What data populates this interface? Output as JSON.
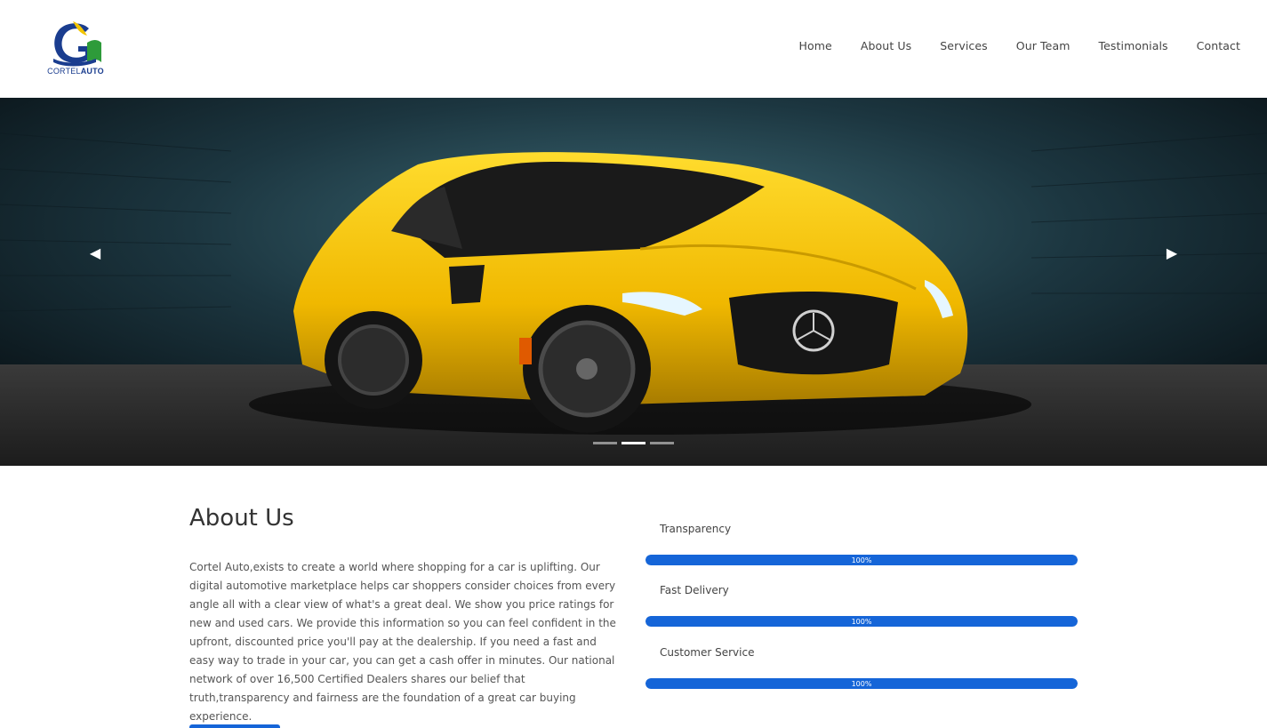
{
  "brand": {
    "logo_name_a": "CORTEL",
    "logo_name_b": "AUTO"
  },
  "nav": {
    "items": [
      "Home",
      "About Us",
      "Services",
      "Our Team",
      "Testimonials",
      "Contact"
    ]
  },
  "carousel": {
    "prev_label": "Previous",
    "next_label": "Next",
    "slide_count": 3,
    "active_index": 1
  },
  "about": {
    "title": "About Us",
    "body": "Cortel Auto,exists to create a world where shopping for a car is uplifting. Our digital automotive marketplace helps car shoppers consider choices from every angle all with a clear view of what's a great deal. We show you price ratings for new and used cars. We provide this information so you can feel confident in the upfront, discounted price you'll pay at the dealership. If you need a fast and easy way to trade in your car, you can get a cash offer in minutes. Our national network of over 16,500 Certified Dealers shares our belief that truth,transparency and fairness are the foundation of a great car buying experience."
  },
  "skills": [
    {
      "label": "Transparency",
      "value": 100,
      "value_text": "100%"
    },
    {
      "label": "Fast Delivery",
      "value": 100,
      "value_text": "100%"
    },
    {
      "label": "Customer Service",
      "value": 100,
      "value_text": "100%"
    }
  ],
  "colors": {
    "accent": "#1565d8",
    "car": "#f2c400",
    "header_bg": "#ffffff"
  }
}
